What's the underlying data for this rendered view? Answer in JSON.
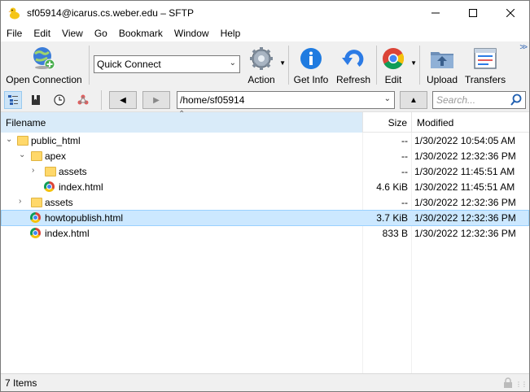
{
  "window": {
    "title": "sf05914@icarus.cs.weber.edu – SFTP"
  },
  "menu": [
    "File",
    "Edit",
    "View",
    "Go",
    "Bookmark",
    "Window",
    "Help"
  ],
  "toolbar": {
    "open_connection": "Open Connection",
    "quick_connect": "Quick Connect",
    "action": "Action",
    "get_info": "Get Info",
    "refresh": "Refresh",
    "edit": "Edit",
    "upload": "Upload",
    "transfers": "Transfers"
  },
  "nav": {
    "path": "/home/sf05914",
    "search_placeholder": "Search..."
  },
  "columns": {
    "filename": "Filename",
    "size": "Size",
    "modified": "Modified"
  },
  "files": [
    {
      "name": "public_html",
      "size": "--",
      "modified": "1/30/2022 10:54:05 AM",
      "type": "folder",
      "level": 0,
      "expanded": true
    },
    {
      "name": "apex",
      "size": "--",
      "modified": "1/30/2022 12:32:36 PM",
      "type": "folder",
      "level": 1,
      "expanded": true
    },
    {
      "name": "assets",
      "size": "--",
      "modified": "1/30/2022 11:45:51 AM",
      "type": "folder",
      "level": 2,
      "expanded": false
    },
    {
      "name": "index.html",
      "size": "4.6 KiB",
      "modified": "1/30/2022 11:45:51 AM",
      "type": "html",
      "level": 2
    },
    {
      "name": "assets",
      "size": "--",
      "modified": "1/30/2022 12:32:36 PM",
      "type": "folder",
      "level": 1,
      "expanded": false
    },
    {
      "name": "howtopublish.html",
      "size": "3.7 KiB",
      "modified": "1/30/2022 12:32:36 PM",
      "type": "html",
      "level": 1,
      "selected": true
    },
    {
      "name": "index.html",
      "size": "833 B",
      "modified": "1/30/2022 12:32:36 PM",
      "type": "html",
      "level": 1
    }
  ],
  "status": {
    "items": "7 Items"
  },
  "colors": {
    "selection": "#cce8ff",
    "header_sort": "#d9ebf9",
    "folder": "#ffd86a"
  }
}
